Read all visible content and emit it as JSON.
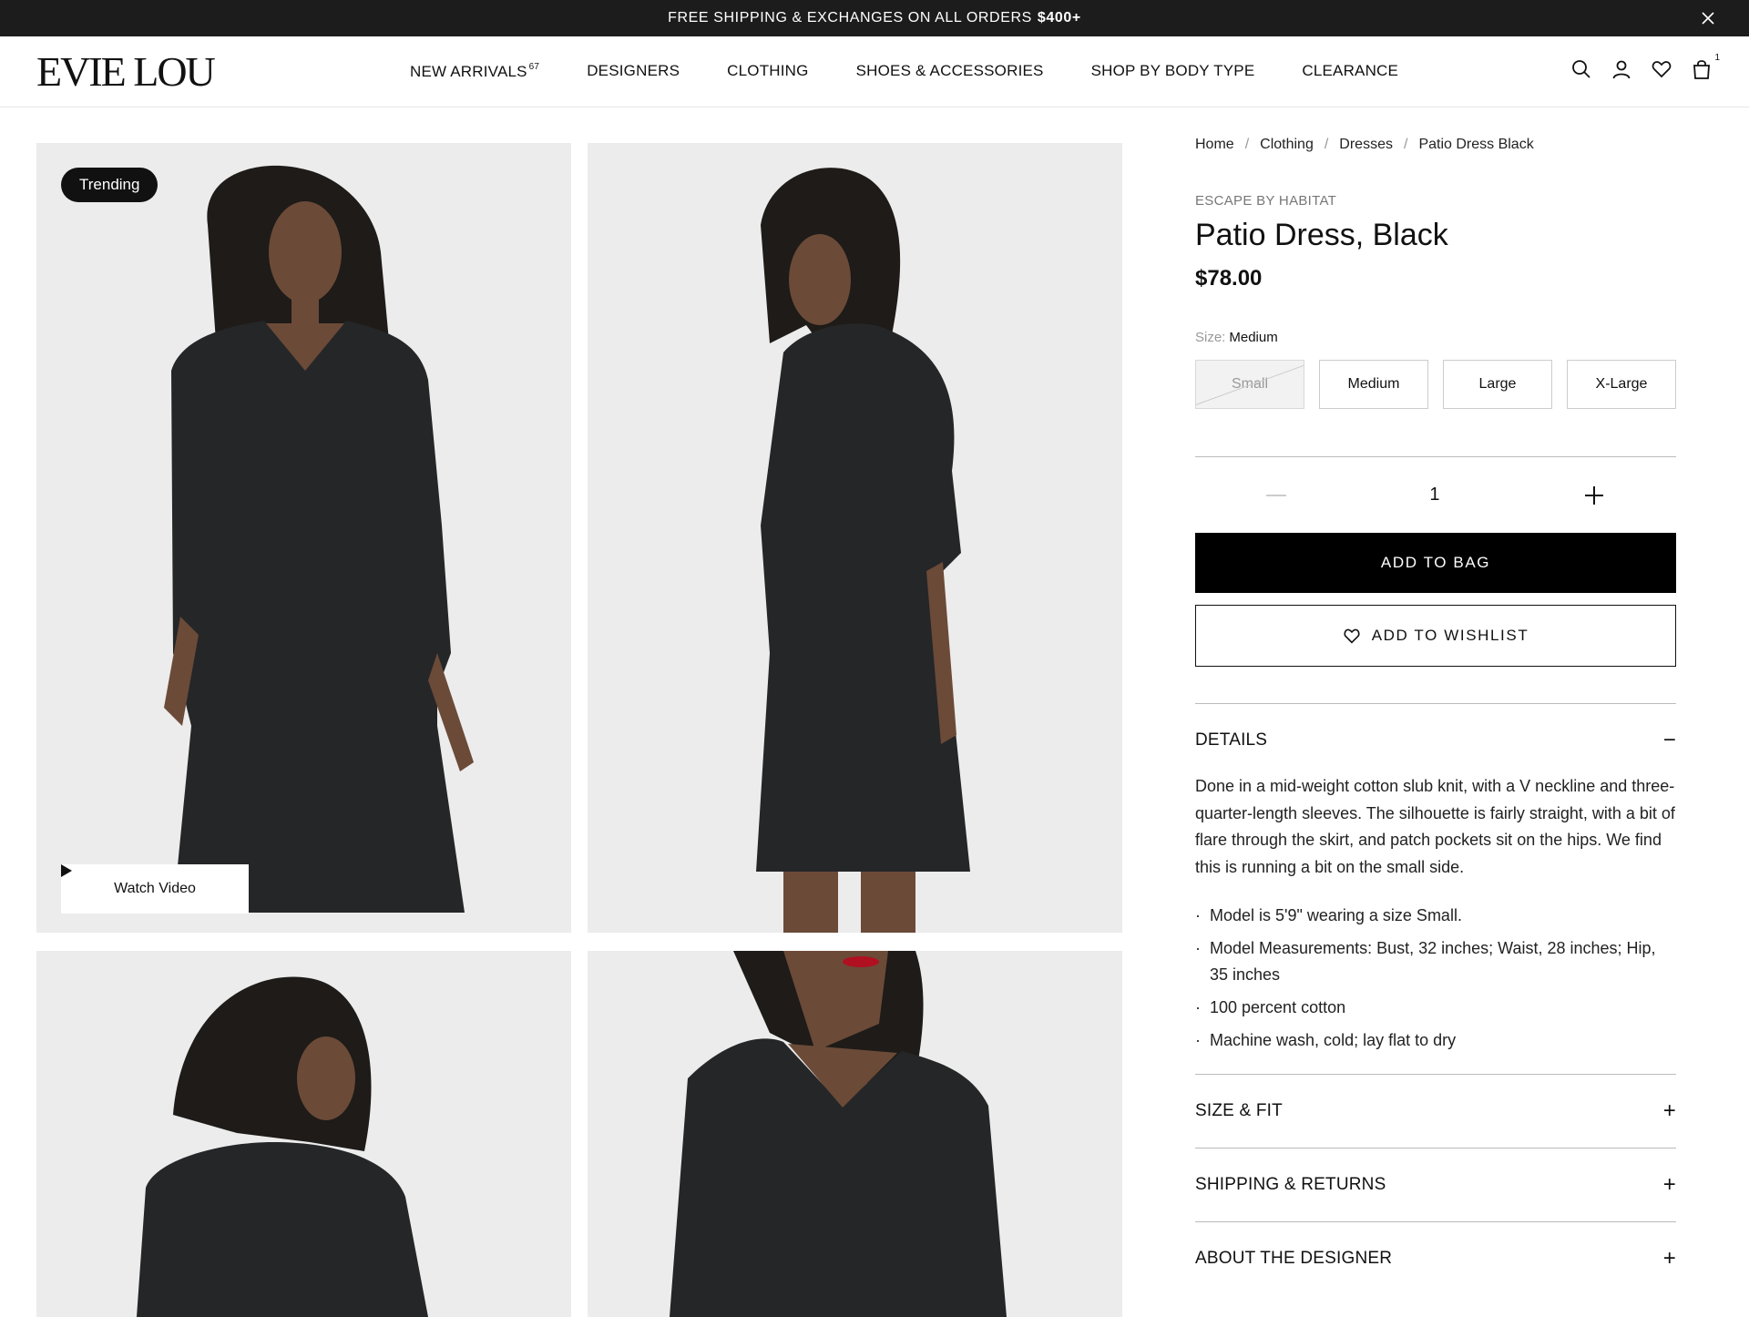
{
  "announcement": {
    "text": "FREE SHIPPING & EXCHANGES ON ALL ORDERS",
    "amount": "$400+"
  },
  "logo": "EVIE LOU",
  "nav": {
    "items": [
      {
        "label": "NEW ARRIVALS",
        "count": "67"
      },
      {
        "label": "DESIGNERS"
      },
      {
        "label": "CLOTHING"
      },
      {
        "label": "SHOES & ACCESSORIES"
      },
      {
        "label": "SHOP BY BODY TYPE"
      },
      {
        "label": "CLEARANCE"
      }
    ],
    "bag_count": "1"
  },
  "gallery": {
    "badge": "Trending",
    "watch_video": "Watch Video"
  },
  "breadcrumb": [
    "Home",
    "Clothing",
    "Dresses",
    "Patio Dress Black"
  ],
  "product": {
    "brand": "ESCAPE BY HABITAT",
    "title": "Patio Dress, Black",
    "price": "$78.00",
    "size_label": "Size:",
    "selected_size": "Medium",
    "sizes": [
      "Small",
      "Medium",
      "Large",
      "X-Large"
    ],
    "quantity": "1",
    "add_to_bag": "ADD TO BAG",
    "add_to_wishlist": "ADD TO WISHLIST"
  },
  "details": {
    "heading": "DETAILS",
    "sign": "−",
    "description": "Done in a mid-weight cotton slub knit, with a V neckline and three-quarter-length sleeves. The silhouette is fairly straight, with a bit of flare through the skirt, and patch pockets sit on the hips. We find this is running a bit on the small side.",
    "bullets": [
      "Model is 5'9\" wearing a size Small.",
      "Model Measurements: Bust, 32 inches; Waist, 28 inches; Hip, 35 inches",
      "100 percent cotton",
      "Machine wash, cold; lay flat to dry"
    ]
  },
  "accordions": [
    {
      "heading": "SIZE & FIT",
      "sign": "+"
    },
    {
      "heading": "SHIPPING & RETURNS",
      "sign": "+"
    },
    {
      "heading": "ABOUT THE DESIGNER",
      "sign": "+"
    }
  ],
  "colors": {
    "announce_bg": "#1c1c1c",
    "button_bg": "#000000",
    "photo_bg": "#e9e9e9"
  }
}
